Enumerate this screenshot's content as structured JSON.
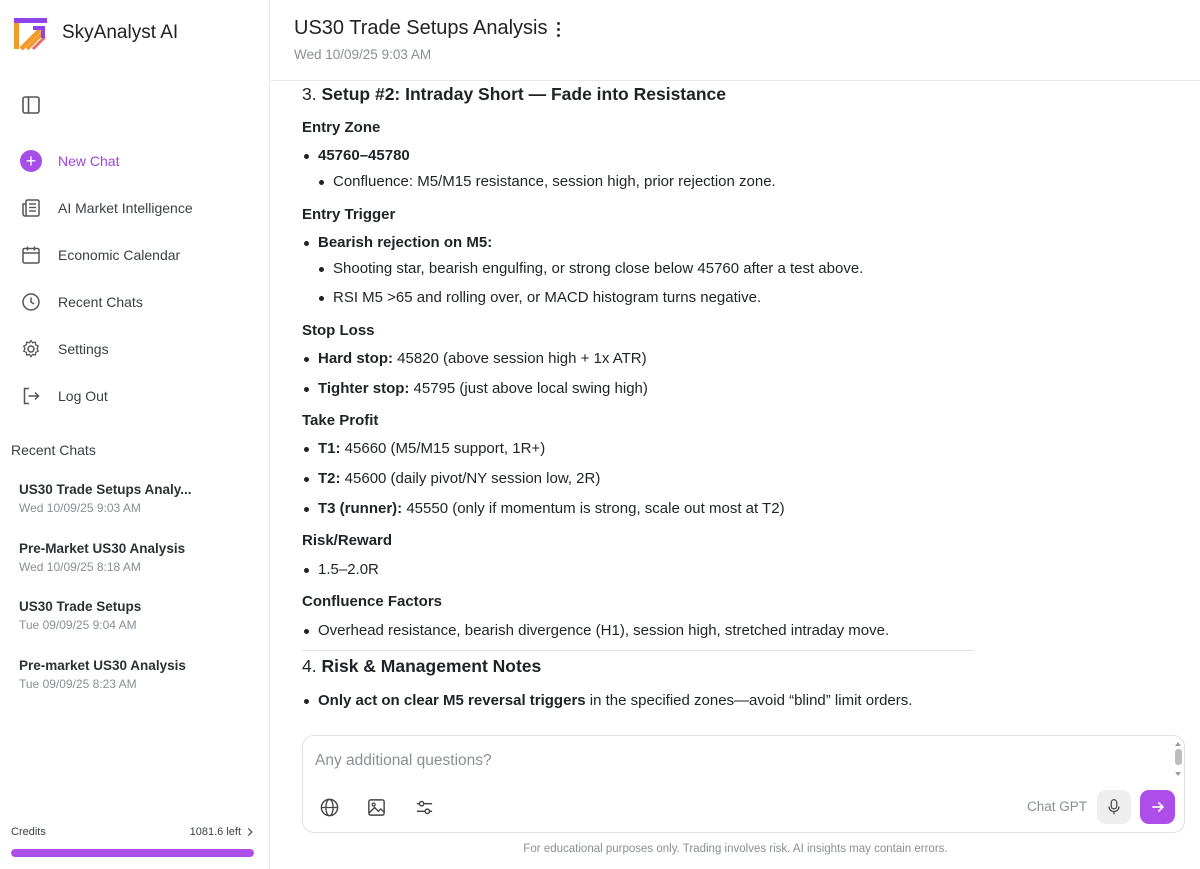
{
  "app": {
    "name": "SkyAnalyst AI"
  },
  "nav": {
    "items": [
      {
        "label": "New Chat",
        "icon": "plus-circle-icon"
      },
      {
        "label": "AI Market Intelligence",
        "icon": "newspaper-icon"
      },
      {
        "label": "Economic Calendar",
        "icon": "calendar-icon"
      },
      {
        "label": "Recent Chats",
        "icon": "clock-icon"
      },
      {
        "label": "Settings",
        "icon": "gear-icon"
      },
      {
        "label": "Log Out",
        "icon": "logout-icon"
      }
    ]
  },
  "recent": {
    "heading": "Recent Chats",
    "items": [
      {
        "title": "US30 Trade Setups Analy...",
        "date": "Wed 10/09/25 9:03 AM"
      },
      {
        "title": "Pre-Market US30 Analysis",
        "date": "Wed 10/09/25 8:18 AM"
      },
      {
        "title": "US30 Trade Setups",
        "date": "Tue 09/09/25 9:04 AM"
      },
      {
        "title": "Pre-market US30 Analysis",
        "date": "Tue 09/09/25 8:23 AM"
      }
    ]
  },
  "credits": {
    "label": "Credits",
    "remaining": "1081.6 left",
    "fill_fraction": 1.0
  },
  "header": {
    "title": "US30 Trade Setups Analysis",
    "date": "Wed 10/09/25 9:03 AM"
  },
  "content": {
    "s3_num": "3.",
    "s3_title": "Setup #2: Intraday Short — Fade into Resistance",
    "entry_zone_h": "Entry Zone",
    "entry_zone_val": "45760–45780",
    "entry_zone_conf": "Confluence: M5/M15 resistance, session high, prior rejection zone.",
    "entry_trigger_h": "Entry Trigger",
    "entry_trigger_val": "Bearish rejection on M5:",
    "entry_trigger_a": "Shooting star, bearish engulfing, or strong close below 45760 after a test above.",
    "entry_trigger_b": "RSI M5 >65 and rolling over, or MACD histogram turns negative.",
    "stop_loss_h": "Stop Loss",
    "hard_stop_b": "Hard stop:",
    "hard_stop_t": " 45820 (above session high + 1x ATR)",
    "tight_stop_b": "Tighter stop:",
    "tight_stop_t": " 45795 (just above local swing high)",
    "tp_h": "Take Profit",
    "t1_b": "T1:",
    "t1_t": " 45660 (M5/M15 support, 1R+)",
    "t2_b": "T2:",
    "t2_t": " 45600 (daily pivot/NY session low, 2R)",
    "t3_b": "T3 (runner):",
    "t3_t": " 45550 (only if momentum is strong, scale out most at T2)",
    "rr_h": "Risk/Reward",
    "rr_val": "1.5–2.0R",
    "cf_h": "Confluence Factors",
    "cf_val": "Overhead resistance, bearish divergence (H1), session high, stretched intraday move.",
    "s4_num": "4.",
    "s4_title": "Risk & Management Notes",
    "s4_b": "Only act on clear M5 reversal triggers",
    "s4_t": " in the specified zones—avoid “blind” limit orders."
  },
  "composer": {
    "placeholder": "Any additional questions?",
    "model": "Chat GPT",
    "tools": [
      "globe-icon",
      "image-icon",
      "sliders-icon"
    ]
  },
  "footer": {
    "disclaimer": "For educational purposes only. Trading involves risk. AI insights may contain errors."
  },
  "colors": {
    "accent": "#ad4ee9",
    "logo_orange": "#f39a2b",
    "logo_purple": "#8e44e8"
  }
}
